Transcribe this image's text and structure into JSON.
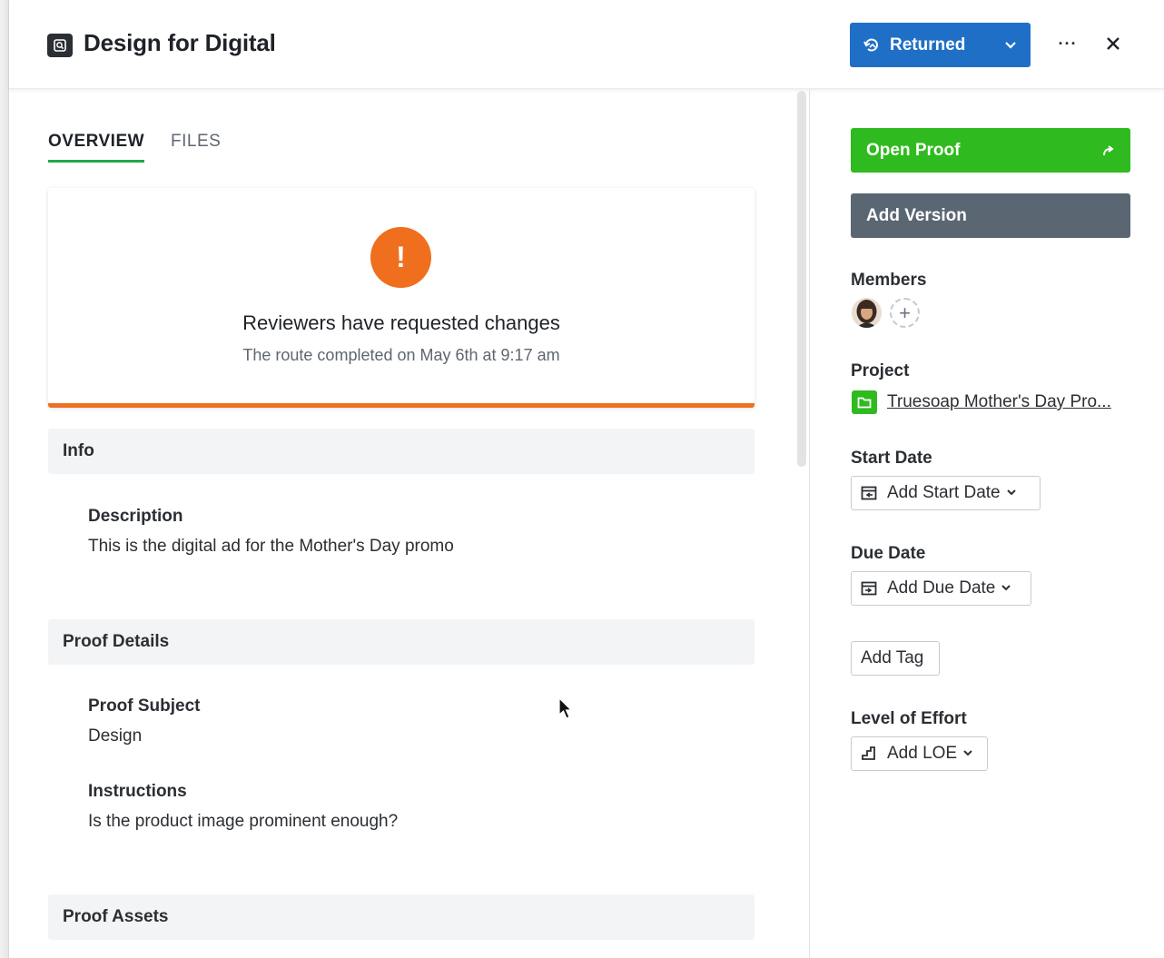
{
  "header": {
    "title": "Design for Digital",
    "status_label": "Returned",
    "more_label": "···"
  },
  "tabs": [
    {
      "label": "OVERVIEW",
      "active": true
    },
    {
      "label": "FILES",
      "active": false
    }
  ],
  "alert": {
    "icon_text": "!",
    "title": "Reviewers have requested changes",
    "subtitle": "The route completed on May 6th at 9:17 am",
    "accent_color": "#ee7121"
  },
  "sections": {
    "info": {
      "title": "Info",
      "description_label": "Description",
      "description_value": "This is the digital ad for the Mother's Day promo"
    },
    "proof_details": {
      "title": "Proof Details",
      "subject_label": "Proof Subject",
      "subject_value": "Design",
      "instructions_label": "Instructions",
      "instructions_value": "Is the product image prominent enough?"
    },
    "proof_assets": {
      "title": "Proof Assets"
    }
  },
  "sidebar": {
    "open_proof_label": "Open Proof",
    "add_version_label": "Add Version",
    "members_label": "Members",
    "add_member_symbol": "+",
    "project_label": "Project",
    "project_name": "Truesoap Mother's Day Pro...",
    "start_date_label": "Start Date",
    "start_date_button": "Add Start Date",
    "due_date_label": "Due Date",
    "due_date_button": "Add Due Date",
    "tag_button": "Add Tag",
    "loe_label": "Level of Effort",
    "loe_button": "Add LOE"
  },
  "colors": {
    "status_blue": "#1f6fc7",
    "primary_green": "#2fbb1f",
    "secondary_gray": "#5a6773",
    "tab_underline": "#22a84a"
  },
  "icons": [
    "proof-app-icon",
    "return-icon",
    "chevron-down-icon",
    "more-icon",
    "close-icon",
    "exclamation-icon",
    "external-link-icon",
    "folder-icon",
    "calendar-start-icon",
    "calendar-due-icon",
    "effort-icon",
    "pointer-cursor-icon"
  ]
}
